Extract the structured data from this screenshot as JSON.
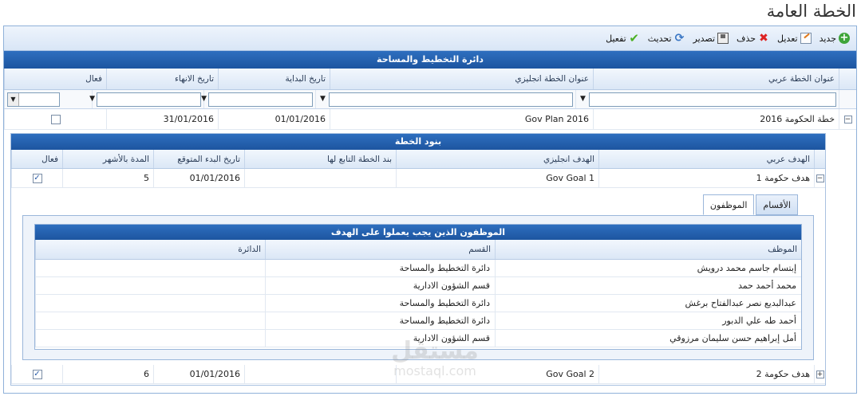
{
  "page_title": "الخطة العامة",
  "toolbar": {
    "new_label": "جديد",
    "edit_label": "تعديل",
    "delete_label": "حذف",
    "export_label": "تصدير",
    "refresh_label": "تحديث",
    "activate_label": "تفعيل"
  },
  "department": {
    "title": "دائرة التخطيط والمساحة"
  },
  "plans_grid": {
    "columns": {
      "title_ar": "عنوان الخطة عربي",
      "title_en": "عنوان الخطة انجليزي",
      "start_date": "تاريخ البداية",
      "end_date": "تاريخ الانهاء",
      "active": "فعال"
    },
    "rows": [
      {
        "title_ar": "خطة الحكومة 2016",
        "title_en": "Gov Plan 2016",
        "start_date": "01/01/2016",
        "end_date": "31/01/2016"
      }
    ]
  },
  "items_grid": {
    "title": "بنود الخطة",
    "columns": {
      "goal_ar": "الهدف عربي",
      "goal_en": "الهدف انجليزي",
      "parent_item": "بند الخطة التابع لها",
      "expected_start": "تاريخ البدء المتوقع",
      "duration": "المدة بالأشهر",
      "active": "فعال"
    },
    "rows": [
      {
        "goal_ar": "هدف حكومة 1",
        "goal_en": "Gov Goal 1",
        "parent_item": "",
        "expected_start": "01/01/2016",
        "duration": "5"
      },
      {
        "goal_ar": "هدف حكومة 2",
        "goal_en": "Gov Goal 2",
        "parent_item": "",
        "expected_start": "01/01/2016",
        "duration": "6"
      }
    ]
  },
  "tabs": {
    "departments": "الأقسام",
    "employees": "الموظفون"
  },
  "employees_grid": {
    "title": "الموظفون الذين يجب يعملوا على الهدف",
    "columns": {
      "employee": "الموظف",
      "section": "القسم",
      "department": "الدائرة"
    },
    "rows": [
      {
        "employee": "إبتسام جاسم محمد درويش",
        "section": "دائرة التخطيط والمساحة",
        "department": ""
      },
      {
        "employee": "محمد أحمد حمد",
        "section": "قسم الشؤون الادارية",
        "department": ""
      },
      {
        "employee": "عبدالبديع نصر عبدالفتاح برغش",
        "section": "دائرة التخطيط والمساحة",
        "department": ""
      },
      {
        "employee": "أحمد طه علي الدبور",
        "section": "دائرة التخطيط والمساحة",
        "department": ""
      },
      {
        "employee": "أمل إبراهيم حسن سليمان مرزوقي",
        "section": "قسم الشؤون الادارية",
        "department": ""
      }
    ]
  },
  "watermark": {
    "line1": "مستقل",
    "line2": "mostaql.com"
  }
}
